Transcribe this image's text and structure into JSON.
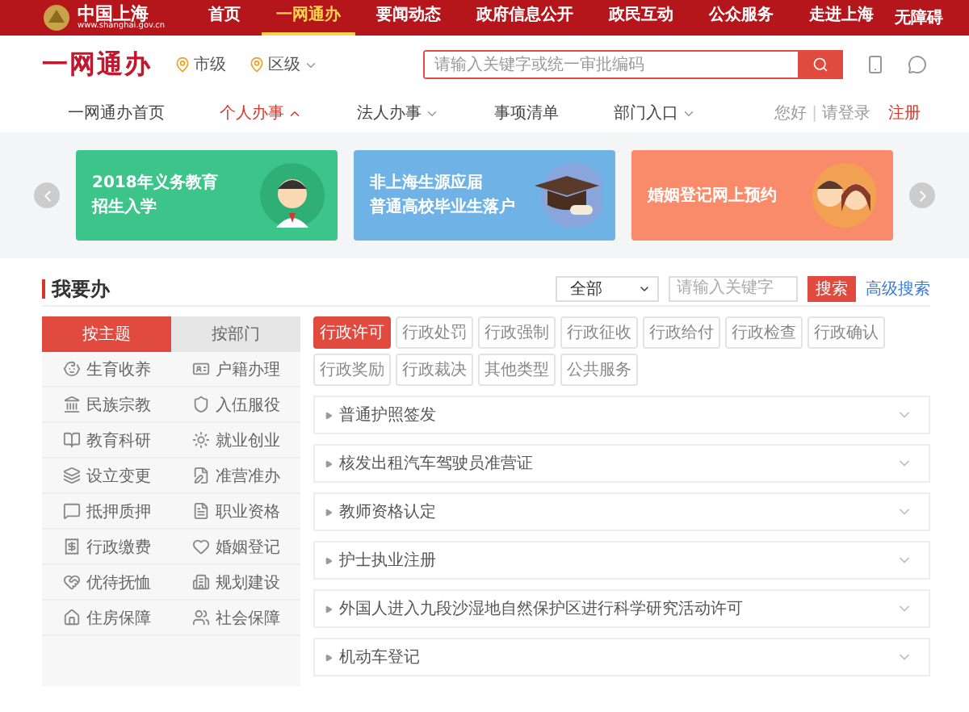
{
  "top_bar": {
    "logo": {
      "title": "中国上海",
      "url": "www.shanghai.gov.cn"
    },
    "items": [
      {
        "label": "首页",
        "selected": false
      },
      {
        "label": "一网通办",
        "selected": true
      },
      {
        "label": "要闻动态",
        "selected": false
      },
      {
        "label": "政府信息公开",
        "selected": false
      },
      {
        "label": "政民互动",
        "selected": false
      },
      {
        "label": "公众服务",
        "selected": false
      },
      {
        "label": "走进上海",
        "selected": false
      }
    ],
    "accessibility": "无障碍"
  },
  "header": {
    "brand": "一网通办",
    "levels": [
      {
        "label": "市级",
        "dropdown": false
      },
      {
        "label": "区级",
        "dropdown": true
      }
    ],
    "search": {
      "placeholder": "请输入关键字或统一审批编码"
    }
  },
  "nav": {
    "items": [
      {
        "label": "一网通办首页",
        "selected": false,
        "dropdown": false
      },
      {
        "label": "个人办事",
        "selected": true,
        "dropdown": true,
        "expanded": true
      },
      {
        "label": "法人办事",
        "selected": false,
        "dropdown": true,
        "expanded": false
      },
      {
        "label": "事项清单",
        "selected": false,
        "dropdown": false
      },
      {
        "label": "部门入口",
        "selected": false,
        "dropdown": true,
        "expanded": false
      }
    ],
    "greeting": "您好",
    "separator": "|",
    "login": "请登录",
    "register": "注册"
  },
  "banners": [
    {
      "lines": [
        "2018年义务教育",
        "招生入学"
      ],
      "kind": "student",
      "color": "#3cc48a"
    },
    {
      "lines": [
        "非上海生源应届",
        "普通高校毕业生落户"
      ],
      "kind": "graduation",
      "color": "#6fb3e6"
    },
    {
      "lines": [
        "婚姻登记网上预约"
      ],
      "kind": "couple",
      "color": "#f98a6a"
    }
  ],
  "section": {
    "title": "我要办",
    "scope": "全部",
    "search": {
      "placeholder": "请输入关键字"
    },
    "search_button": "搜索",
    "advanced": "高级搜索"
  },
  "left_tabs": [
    {
      "label": "按主题",
      "selected": true
    },
    {
      "label": "按部门",
      "selected": false
    }
  ],
  "topics": [
    "生育收养",
    "户籍办理",
    "民族宗教",
    "入伍服役",
    "教育科研",
    "就业创业",
    "设立变更",
    "准营准办",
    "抵押质押",
    "职业资格",
    "行政缴费",
    "婚姻登记",
    "优待抚恤",
    "规划建设",
    "住房保障",
    "社会保障"
  ],
  "filters": [
    {
      "label": "行政许可",
      "selected": true
    },
    {
      "label": "行政处罚",
      "selected": false
    },
    {
      "label": "行政强制",
      "selected": false
    },
    {
      "label": "行政征收",
      "selected": false
    },
    {
      "label": "行政给付",
      "selected": false
    },
    {
      "label": "行政检查",
      "selected": false
    },
    {
      "label": "行政确认",
      "selected": false
    },
    {
      "label": "行政奖励",
      "selected": false
    },
    {
      "label": "行政裁决",
      "selected": false
    },
    {
      "label": "其他类型",
      "selected": false
    },
    {
      "label": "公共服务",
      "selected": false
    }
  ],
  "items": [
    {
      "label": "普通护照签发",
      "expanded": false
    },
    {
      "label": "核发出租汽车驾驶员准营证",
      "expanded": false
    },
    {
      "label": "教师资格认定",
      "expanded": false
    },
    {
      "label": "护士执业注册",
      "expanded": false
    },
    {
      "label": "外国人进入九段沙湿地自然保护区进行科学研究活动许可",
      "expanded": false
    },
    {
      "label": "机动车登记",
      "expanded": false
    }
  ]
}
